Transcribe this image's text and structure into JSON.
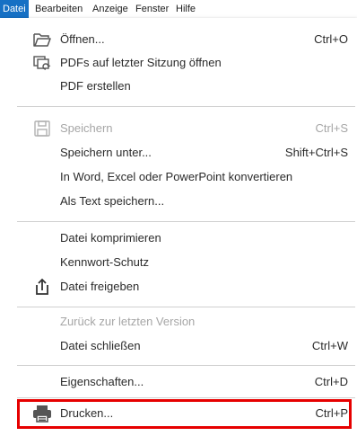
{
  "menubar": {
    "items": [
      "Datei",
      "Bearbeiten",
      "Anzeige",
      "Fenster",
      "Hilfe"
    ]
  },
  "menu": {
    "open": {
      "label": "Öffnen...",
      "shortcut": "Ctrl+O"
    },
    "open_last_session": {
      "label": "PDFs auf letzter Sitzung öffnen"
    },
    "create_pdf": {
      "label": "PDF erstellen"
    },
    "save": {
      "label": "Speichern",
      "shortcut": "Ctrl+S"
    },
    "save_as": {
      "label": "Speichern unter...",
      "shortcut": "Shift+Ctrl+S"
    },
    "convert": {
      "label": "In Word, Excel oder PowerPoint konvertieren"
    },
    "save_as_text": {
      "label": "Als Text speichern..."
    },
    "compress": {
      "label": "Datei komprimieren"
    },
    "password_protect": {
      "label": "Kennwort-Schutz"
    },
    "share": {
      "label": "Datei freigeben"
    },
    "revert": {
      "label": "Zurück zur letzten Version"
    },
    "close": {
      "label": "Datei schließen",
      "shortcut": "Ctrl+W"
    },
    "properties": {
      "label": "Eigenschaften...",
      "shortcut": "Ctrl+D"
    },
    "print": {
      "label": "Drucken...",
      "shortcut": "Ctrl+P"
    }
  },
  "colors": {
    "menubar_active": "#1670c4",
    "highlight_border": "#e60000",
    "disabled_text": "#a6a6a6"
  }
}
